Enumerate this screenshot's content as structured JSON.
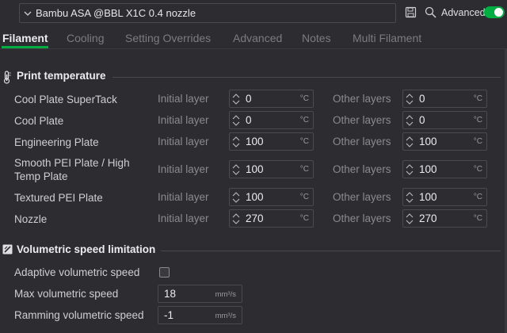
{
  "preset": {
    "name": "Bambu ASA @BBL X1C 0.4 nozzle"
  },
  "toolbar": {
    "advanced_label": "Advanced",
    "advanced_on": true,
    "accent": "#00ae42"
  },
  "tabs": [
    {
      "label": "Filament",
      "active": true
    },
    {
      "label": "Cooling"
    },
    {
      "label": "Setting Overrides"
    },
    {
      "label": "Advanced"
    },
    {
      "label": "Notes"
    },
    {
      "label": "Multi Filament"
    }
  ],
  "print_temperature": {
    "title": "Print temperature",
    "initial_label": "Initial layer",
    "other_label": "Other layers",
    "unit": "°C",
    "rows": [
      {
        "label": "Cool Plate SuperTack",
        "initial": "0",
        "other": "0"
      },
      {
        "label": "Cool Plate",
        "initial": "0",
        "other": "0"
      },
      {
        "label": "Engineering Plate",
        "initial": "100",
        "other": "100"
      },
      {
        "label": "Smooth PEI Plate / High Temp Plate",
        "line1": "Smooth PEI Plate / High",
        "line2": "Temp Plate",
        "initial": "100",
        "other": "100"
      },
      {
        "label": "Textured PEI Plate",
        "initial": "100",
        "other": "100"
      },
      {
        "label": "Nozzle",
        "initial": "270",
        "other": "270"
      }
    ]
  },
  "volumetric": {
    "title": "Volumetric speed limitation",
    "adaptive_label": "Adaptive volumetric speed",
    "adaptive_checked": false,
    "max_label": "Max volumetric speed",
    "max_value": "18",
    "ramming_label": "Ramming volumetric speed",
    "ramming_value": "-1",
    "unit": "mm³/s"
  }
}
